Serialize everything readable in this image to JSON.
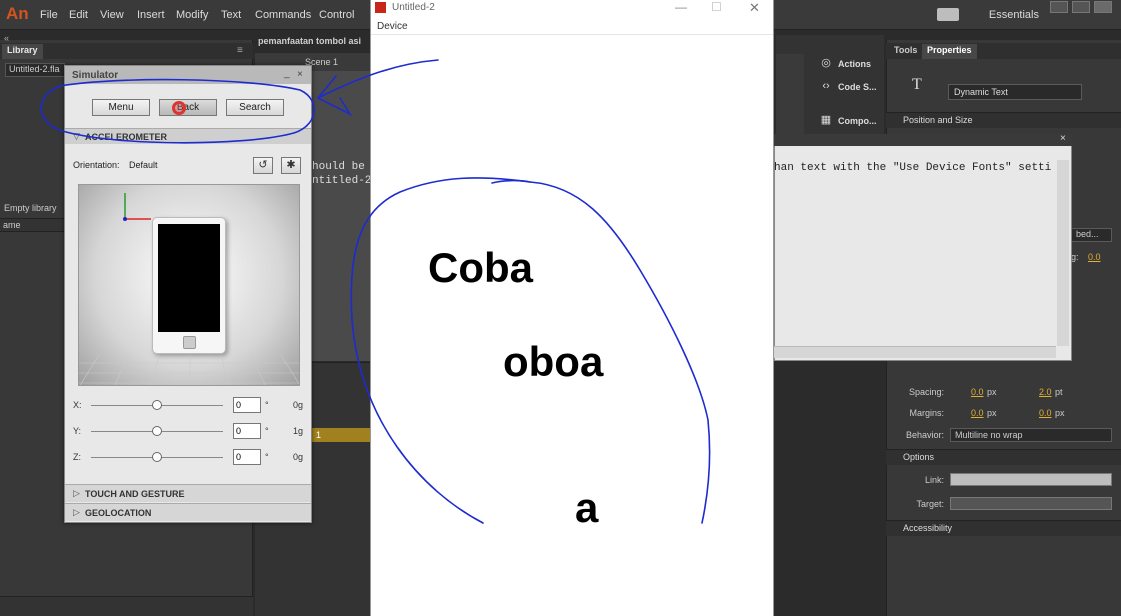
{
  "app": {
    "logo": "An"
  },
  "menubar": {
    "items": [
      "File",
      "Edit",
      "View",
      "Insert",
      "Modify",
      "Text",
      "Commands",
      "Control"
    ],
    "workspace": "Essentials"
  },
  "library": {
    "tab": "Library",
    "document": "Untitled-2.fla",
    "empty_text": "Empty library",
    "column_name": "ame"
  },
  "stage": {
    "doc_title": "pemanfaatan tombol asi",
    "scene": "Scene 1",
    "code_lines": [
      "hould be",
      "ntitled-2"
    ],
    "timeline_frame": "1"
  },
  "simulator": {
    "title": "Simulator",
    "buttons": [
      "Menu",
      "Back",
      "Search"
    ],
    "accelerometer_label": "ACCELEROMETER",
    "orientation_label": "Orientation:",
    "orientation_value": "Default",
    "sliders": [
      {
        "axis": "X:",
        "value": "0",
        "unit": "°",
        "reading": "0g"
      },
      {
        "axis": "Y:",
        "value": "0",
        "unit": "°",
        "reading": "1g"
      },
      {
        "axis": "Z:",
        "value": "0",
        "unit": "°",
        "reading": "0g"
      }
    ],
    "sections": [
      "TOUCH AND GESTURE",
      "GEOLOCATION"
    ]
  },
  "device_window": {
    "title": "Untitled-2",
    "menu": "Device",
    "texts": [
      "Coba",
      "oboa",
      "a"
    ]
  },
  "tools": {
    "items": [
      "Actions",
      "Code S...",
      "Compo..."
    ]
  },
  "properties": {
    "tabs": [
      "Tools",
      "Properties"
    ],
    "text_type": "Dynamic Text",
    "position_section": "Position and Size",
    "options_section": "Options",
    "accessibility_section": "Accessibility",
    "embed_button": "bed...",
    "spacing_label": "Spacing:",
    "spacing_value": "0.0",
    "spacing_unit": "px",
    "line_spacing_value": "2.0",
    "line_spacing_unit": "pt",
    "margins_label": "Margins:",
    "margin_left": "0.0",
    "margin_right": "0.0",
    "margins_unit": "px",
    "behavior_label": "Behavior:",
    "behavior_value": "Multiline no wrap",
    "link_label": "Link:",
    "target_label": "Target:",
    "letter_spacing_label": "g:",
    "letter_spacing_value": "0.0"
  },
  "output": {
    "text": "han text with the \"Use Device Fonts\" setti"
  },
  "colors": {
    "annotation": "#1d2bd0",
    "accent": "#e0b030"
  }
}
